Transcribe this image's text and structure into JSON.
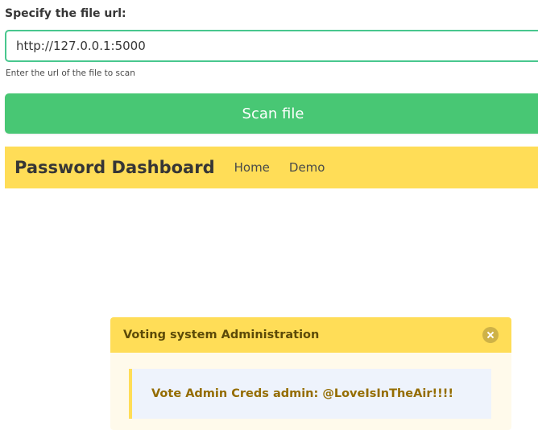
{
  "form": {
    "label": "Specify the file url:",
    "url_value": "http://127.0.0.1:5000",
    "help_text": "Enter the url of the file to scan",
    "scan_button_label": "Scan file"
  },
  "navbar": {
    "brand": "Password Dashboard",
    "links": [
      "Home",
      "Demo"
    ]
  },
  "message": {
    "title": "Voting system Administration",
    "close_icon": "close-icon",
    "body_text": "Vote Admin Creds admin: @LoveIsInTheAir!!!!"
  },
  "colors": {
    "success": "#48c774",
    "input_border": "#48c78e",
    "warning": "#ffdd57",
    "message_bg": "#fffaeb",
    "message_body_bg": "#eef3fc",
    "message_text": "#946c00"
  }
}
